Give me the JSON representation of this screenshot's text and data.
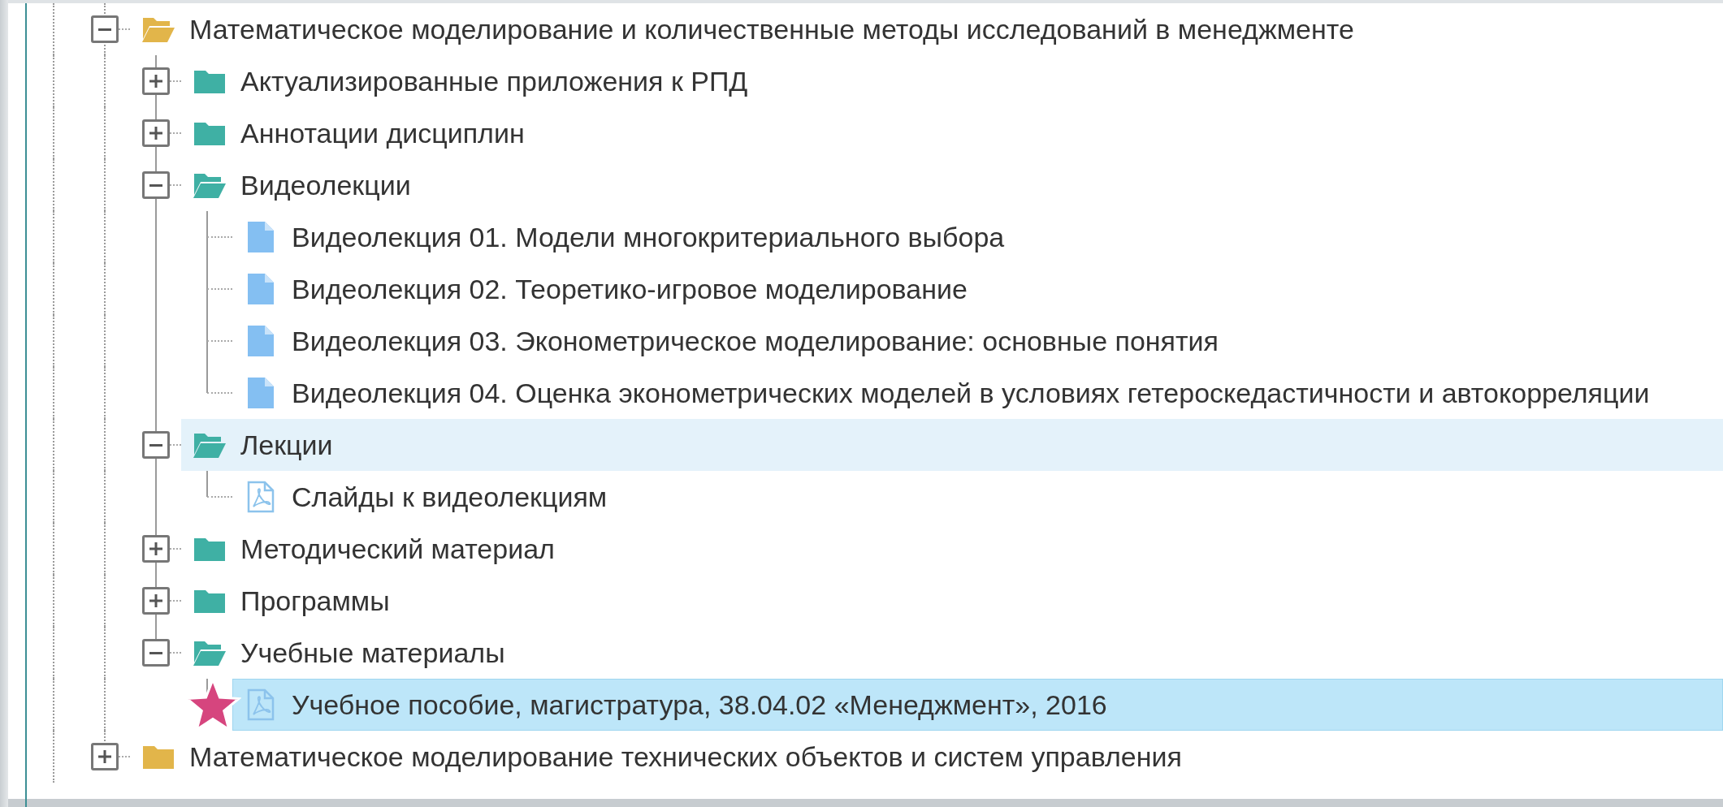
{
  "tree": [
    {
      "kind": "folder",
      "label": "Математическое моделирование и количественные методы исследований в менеджменте",
      "color": "#e2b54a",
      "expanded": true,
      "selected": false,
      "hovered": false,
      "starred": false,
      "children": [
        {
          "kind": "folder",
          "label": "Актуализированные приложения к РПД",
          "color": "#3fb0a4",
          "expanded": false,
          "selected": false,
          "hovered": false,
          "starred": false
        },
        {
          "kind": "folder",
          "label": "Аннотации дисциплин",
          "color": "#3fb0a4",
          "expanded": false,
          "selected": false,
          "hovered": false,
          "starred": false
        },
        {
          "kind": "folder",
          "label": "Видеолекции",
          "color": "#3fb0a4",
          "expanded": true,
          "selected": false,
          "hovered": false,
          "starred": false,
          "children": [
            {
              "kind": "document",
              "label": "Видеолекция 01. Модели многокритериального выбора",
              "selected": false,
              "hovered": false,
              "starred": false
            },
            {
              "kind": "document",
              "label": "Видеолекция 02. Теоретико-игровое моделирование",
              "selected": false,
              "hovered": false,
              "starred": false
            },
            {
              "kind": "document",
              "label": "Видеолекция 03. Эконометрическое моделирование: основные понятия",
              "selected": false,
              "hovered": false,
              "starred": false
            },
            {
              "kind": "document",
              "label": "Видеолекция 04. Оценка эконометрических моделей в условиях гетероскедастичности и автокорреляции",
              "selected": false,
              "hovered": false,
              "starred": false
            }
          ]
        },
        {
          "kind": "folder",
          "label": "Лекции",
          "color": "#3fb0a4",
          "expanded": true,
          "selected": false,
          "hovered": true,
          "starred": false,
          "children": [
            {
              "kind": "pdf",
              "label": "Слайды к видеолекциям",
              "selected": false,
              "hovered": false,
              "starred": false
            }
          ]
        },
        {
          "kind": "folder",
          "label": "Методический материал",
          "color": "#3fb0a4",
          "expanded": false,
          "selected": false,
          "hovered": false,
          "starred": false
        },
        {
          "kind": "folder",
          "label": "Программы",
          "color": "#3fb0a4",
          "expanded": false,
          "selected": false,
          "hovered": false,
          "starred": false
        },
        {
          "kind": "folder",
          "label": "Учебные материалы",
          "color": "#3fb0a4",
          "expanded": true,
          "selected": false,
          "hovered": false,
          "starred": false,
          "children": [
            {
              "kind": "pdf",
              "label": "Учебное пособие, магистратура, 38.04.02 «Менеджмент», 2016",
              "selected": true,
              "hovered": false,
              "starred": true
            }
          ]
        }
      ]
    },
    {
      "kind": "folder",
      "label": "Математическое моделирование технических объектов и систем управления",
      "color": "#e2b54a",
      "expanded": false,
      "selected": false,
      "hovered": false,
      "starred": false
    }
  ]
}
